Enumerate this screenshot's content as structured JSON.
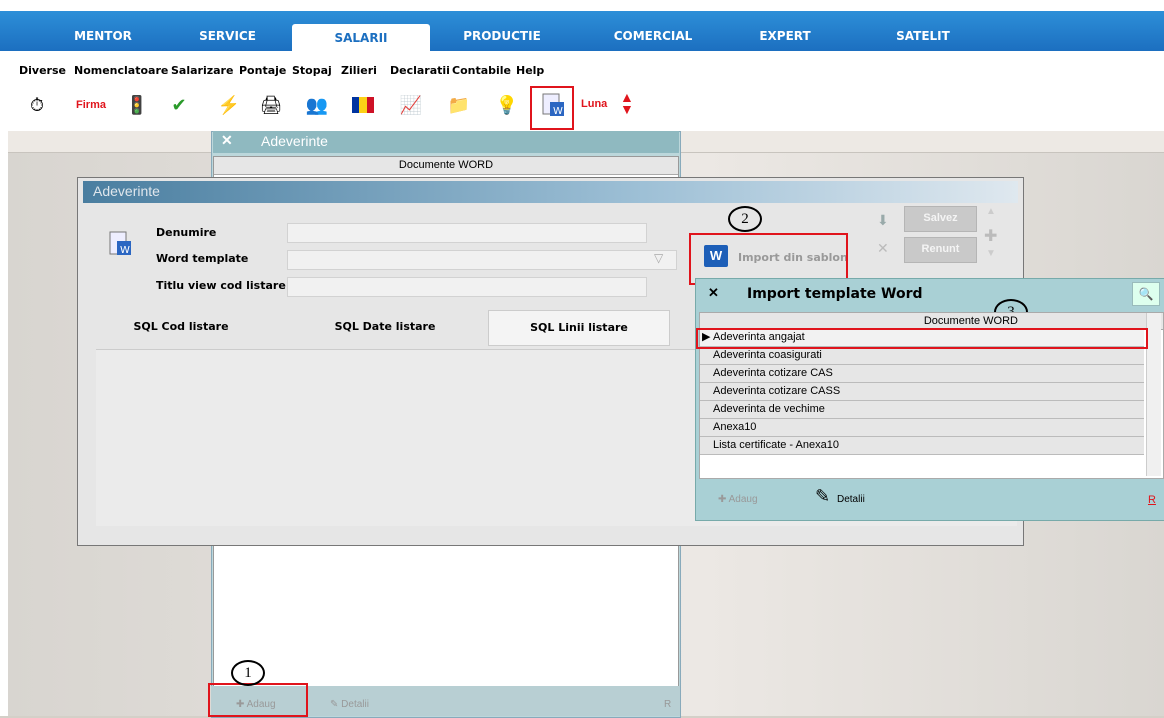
{
  "tabs": [
    {
      "label": "MENTOR"
    },
    {
      "label": "SERVICE"
    },
    {
      "label": "SALARII",
      "active": true
    },
    {
      "label": "PRODUCTIE"
    },
    {
      "label": "COMERCIAL"
    },
    {
      "label": "EXPERT"
    },
    {
      "label": "SATELIT"
    }
  ],
  "menu": [
    "Diverse",
    "Nomenclatoare",
    "Salarizare",
    "Pontaje",
    "Stopaj",
    "Zilieri",
    "Declaratii",
    "Contabile",
    "Help"
  ],
  "toolbar": {
    "firma": "Firma",
    "luna": "Luna"
  },
  "list_panel": {
    "title": "Adeverinte",
    "column": "Documente WORD",
    "add": "Adaug",
    "details": "Detalii",
    "r": "R"
  },
  "modal": {
    "title": "Adeverinte",
    "fields": [
      {
        "label": "Denumire",
        "value": ""
      },
      {
        "label": "Word template",
        "value": ""
      },
      {
        "label": "Titlu view cod listare",
        "value": ""
      }
    ],
    "import_button": "Import din sablon",
    "save": "Salvez",
    "cancel": "Renunt",
    "tabs": [
      "SQL Cod listare",
      "SQL Date listare",
      "SQL Linii listare"
    ]
  },
  "popup": {
    "title": "Import template Word",
    "column": "Documente WORD",
    "rows": [
      "Adeverinta angajat",
      "Adeverinta coasigurati",
      "Adeverinta cotizare  CAS",
      "Adeverinta cotizare CASS",
      "Adeverinta de vechime",
      "Anexa10",
      "Lista certificate - Anexa10"
    ],
    "add": "Adaug",
    "details": "Detalii",
    "r": "R"
  },
  "annotations": [
    "1",
    "2",
    "3"
  ],
  "colors": {
    "accent": "#1c6fc0",
    "highlight": "#e0141c"
  }
}
